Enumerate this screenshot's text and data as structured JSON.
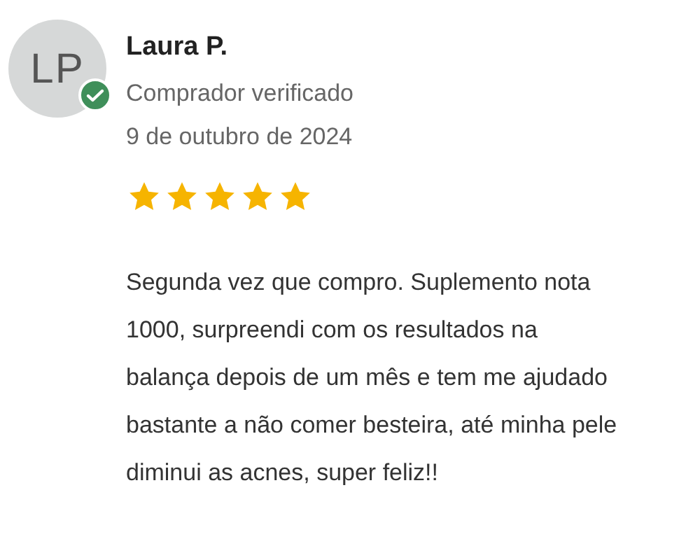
{
  "review": {
    "avatar": {
      "initials": "LP",
      "verified": true
    },
    "name": "Laura P.",
    "status": "Comprador verificado",
    "date": "9 de outubro de 2024",
    "stars": 5,
    "text": "Segunda vez que compro. Suplemento nota 1000, surpreendi com os resultados na balança depois de um mês e tem me ajudado bastante a não comer besteira, até minha pele diminui as acnes, super feliz!!"
  }
}
